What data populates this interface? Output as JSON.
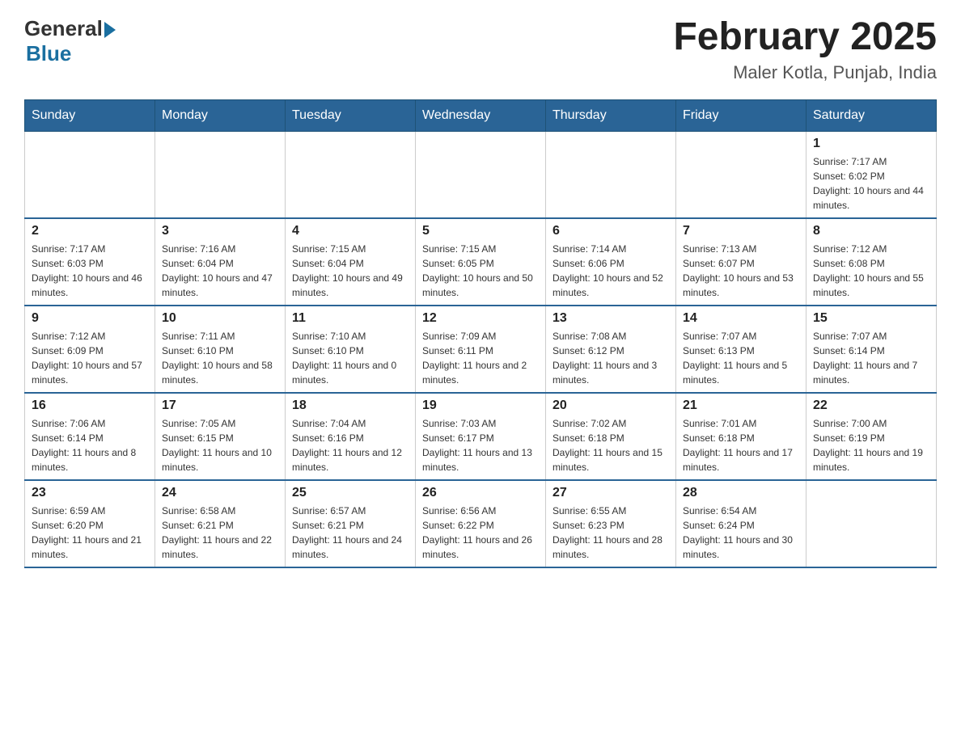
{
  "header": {
    "logo_general": "General",
    "logo_blue": "Blue",
    "month_title": "February 2025",
    "location": "Maler Kotla, Punjab, India"
  },
  "days_of_week": [
    "Sunday",
    "Monday",
    "Tuesday",
    "Wednesday",
    "Thursday",
    "Friday",
    "Saturday"
  ],
  "weeks": [
    {
      "days": [
        {
          "num": "",
          "info": ""
        },
        {
          "num": "",
          "info": ""
        },
        {
          "num": "",
          "info": ""
        },
        {
          "num": "",
          "info": ""
        },
        {
          "num": "",
          "info": ""
        },
        {
          "num": "",
          "info": ""
        },
        {
          "num": "1",
          "info": "Sunrise: 7:17 AM\nSunset: 6:02 PM\nDaylight: 10 hours and 44 minutes."
        }
      ]
    },
    {
      "days": [
        {
          "num": "2",
          "info": "Sunrise: 7:17 AM\nSunset: 6:03 PM\nDaylight: 10 hours and 46 minutes."
        },
        {
          "num": "3",
          "info": "Sunrise: 7:16 AM\nSunset: 6:04 PM\nDaylight: 10 hours and 47 minutes."
        },
        {
          "num": "4",
          "info": "Sunrise: 7:15 AM\nSunset: 6:04 PM\nDaylight: 10 hours and 49 minutes."
        },
        {
          "num": "5",
          "info": "Sunrise: 7:15 AM\nSunset: 6:05 PM\nDaylight: 10 hours and 50 minutes."
        },
        {
          "num": "6",
          "info": "Sunrise: 7:14 AM\nSunset: 6:06 PM\nDaylight: 10 hours and 52 minutes."
        },
        {
          "num": "7",
          "info": "Sunrise: 7:13 AM\nSunset: 6:07 PM\nDaylight: 10 hours and 53 minutes."
        },
        {
          "num": "8",
          "info": "Sunrise: 7:12 AM\nSunset: 6:08 PM\nDaylight: 10 hours and 55 minutes."
        }
      ]
    },
    {
      "days": [
        {
          "num": "9",
          "info": "Sunrise: 7:12 AM\nSunset: 6:09 PM\nDaylight: 10 hours and 57 minutes."
        },
        {
          "num": "10",
          "info": "Sunrise: 7:11 AM\nSunset: 6:10 PM\nDaylight: 10 hours and 58 minutes."
        },
        {
          "num": "11",
          "info": "Sunrise: 7:10 AM\nSunset: 6:10 PM\nDaylight: 11 hours and 0 minutes."
        },
        {
          "num": "12",
          "info": "Sunrise: 7:09 AM\nSunset: 6:11 PM\nDaylight: 11 hours and 2 minutes."
        },
        {
          "num": "13",
          "info": "Sunrise: 7:08 AM\nSunset: 6:12 PM\nDaylight: 11 hours and 3 minutes."
        },
        {
          "num": "14",
          "info": "Sunrise: 7:07 AM\nSunset: 6:13 PM\nDaylight: 11 hours and 5 minutes."
        },
        {
          "num": "15",
          "info": "Sunrise: 7:07 AM\nSunset: 6:14 PM\nDaylight: 11 hours and 7 minutes."
        }
      ]
    },
    {
      "days": [
        {
          "num": "16",
          "info": "Sunrise: 7:06 AM\nSunset: 6:14 PM\nDaylight: 11 hours and 8 minutes."
        },
        {
          "num": "17",
          "info": "Sunrise: 7:05 AM\nSunset: 6:15 PM\nDaylight: 11 hours and 10 minutes."
        },
        {
          "num": "18",
          "info": "Sunrise: 7:04 AM\nSunset: 6:16 PM\nDaylight: 11 hours and 12 minutes."
        },
        {
          "num": "19",
          "info": "Sunrise: 7:03 AM\nSunset: 6:17 PM\nDaylight: 11 hours and 13 minutes."
        },
        {
          "num": "20",
          "info": "Sunrise: 7:02 AM\nSunset: 6:18 PM\nDaylight: 11 hours and 15 minutes."
        },
        {
          "num": "21",
          "info": "Sunrise: 7:01 AM\nSunset: 6:18 PM\nDaylight: 11 hours and 17 minutes."
        },
        {
          "num": "22",
          "info": "Sunrise: 7:00 AM\nSunset: 6:19 PM\nDaylight: 11 hours and 19 minutes."
        }
      ]
    },
    {
      "days": [
        {
          "num": "23",
          "info": "Sunrise: 6:59 AM\nSunset: 6:20 PM\nDaylight: 11 hours and 21 minutes."
        },
        {
          "num": "24",
          "info": "Sunrise: 6:58 AM\nSunset: 6:21 PM\nDaylight: 11 hours and 22 minutes."
        },
        {
          "num": "25",
          "info": "Sunrise: 6:57 AM\nSunset: 6:21 PM\nDaylight: 11 hours and 24 minutes."
        },
        {
          "num": "26",
          "info": "Sunrise: 6:56 AM\nSunset: 6:22 PM\nDaylight: 11 hours and 26 minutes."
        },
        {
          "num": "27",
          "info": "Sunrise: 6:55 AM\nSunset: 6:23 PM\nDaylight: 11 hours and 28 minutes."
        },
        {
          "num": "28",
          "info": "Sunrise: 6:54 AM\nSunset: 6:24 PM\nDaylight: 11 hours and 30 minutes."
        },
        {
          "num": "",
          "info": ""
        }
      ]
    }
  ]
}
